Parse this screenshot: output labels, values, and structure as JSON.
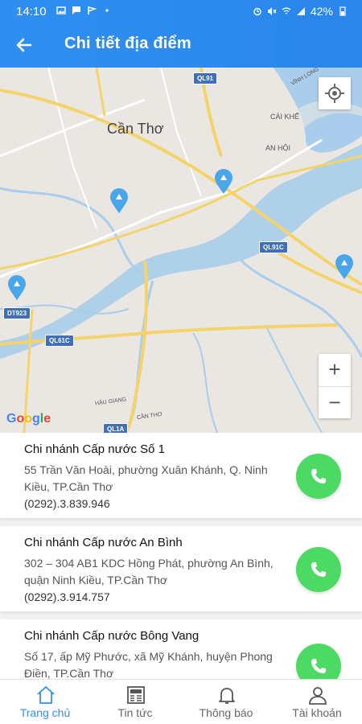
{
  "status_bar": {
    "time": "14:10",
    "battery": "42%"
  },
  "app_bar": {
    "title": "Chi tiết địa điểm",
    "back_icon": "arrow-left-icon"
  },
  "map": {
    "city_label": "Cần Thơ",
    "place_labels": [
      "CÁI KHẾ",
      "AN HỘI",
      "VĨNH LONG",
      "HẬU GIANG",
      "CẦN THƠ"
    ],
    "road_shields": [
      "QL91",
      "QL91C",
      "DT923",
      "QL61C",
      "QL1A"
    ],
    "zoom_in": "+",
    "zoom_out": "−",
    "attribution": "Google",
    "my_location_icon": "crosshair-icon",
    "marker_icon": "water-drop-pin-icon"
  },
  "branches": [
    {
      "name": "Chi nhánh Cấp nước Số 1",
      "address": "55 Trần Văn Hoài, phường Xuân Khánh, Q. Ninh Kiều, TP.Cần Thơ",
      "phone": "(0292).3.839.946"
    },
    {
      "name": "Chi nhánh Cấp nước An Bình",
      "address": "302 – 304 AB1 KDC Hồng Phát,  phường An Bình, quận Ninh Kiều, TP.Cần Thơ",
      "phone": "(0292).3.914.757"
    },
    {
      "name": "Chi nhánh Cấp nước Bông Vang",
      "address": "Số 17, ấp Mỹ Phước, xã Mỹ Khánh, huyện Phong Điền, TP.Cần Thơ",
      "phone": ""
    }
  ],
  "bottom_nav": [
    {
      "label": "Trang chủ",
      "icon": "home-icon",
      "active": true
    },
    {
      "label": "Tin tức",
      "icon": "newspaper-icon",
      "active": false
    },
    {
      "label": "Thông báo",
      "icon": "bell-icon",
      "active": false
    },
    {
      "label": "Tài khoản",
      "icon": "user-icon",
      "active": false
    }
  ],
  "colors": {
    "primary": "#2f8ff0",
    "call_green": "#4cd964",
    "river": "#9dc7e8",
    "road": "#f5d36b"
  }
}
